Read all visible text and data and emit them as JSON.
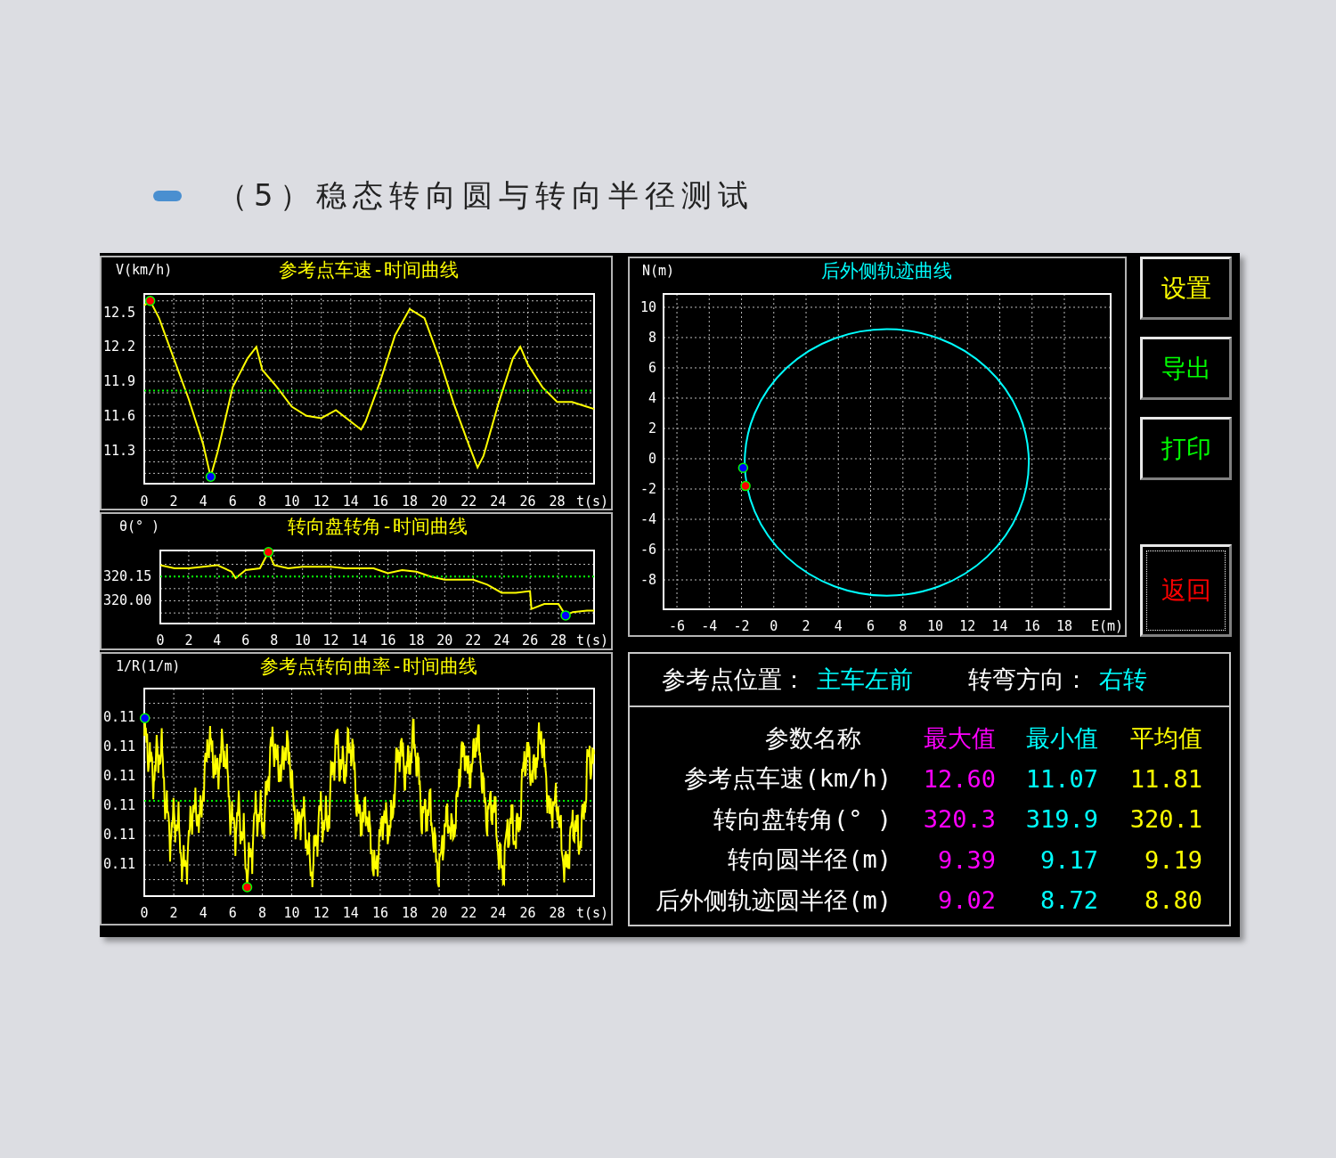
{
  "page_title": "（5）稳态转向圆与转向半径测试",
  "speed_chart": {
    "chart_data": {
      "type": "line",
      "title": "参考点车速-时间曲线",
      "xlabel": "t(s)",
      "ylabel": "V(km/h)",
      "x": [
        0,
        0.4,
        1,
        2,
        3,
        4,
        4.5,
        5,
        6,
        7,
        7.6,
        8,
        9,
        10,
        11,
        12,
        13,
        14,
        14.7,
        15,
        16,
        17,
        18,
        19,
        20,
        21,
        22,
        22.6,
        23,
        24,
        25,
        25.5,
        26,
        27,
        28,
        29,
        30,
        30.5
      ],
      "series": [
        {
          "color": "#ffff00",
          "values": [
            12.56,
            12.6,
            12.45,
            12.1,
            11.75,
            11.35,
            11.07,
            11.3,
            11.85,
            12.1,
            12.2,
            12.0,
            11.85,
            11.68,
            11.6,
            11.58,
            11.65,
            11.55,
            11.48,
            11.55,
            11.9,
            12.3,
            12.53,
            12.45,
            12.1,
            11.7,
            11.35,
            11.15,
            11.25,
            11.7,
            12.1,
            12.2,
            12.05,
            11.85,
            11.72,
            11.72,
            11.68,
            11.66
          ]
        },
        {
          "color": "#00ff00",
          "line_style": "dotted",
          "values": [
            11.82,
            11.82,
            11.82,
            11.82,
            11.82,
            11.82,
            11.82,
            11.82,
            11.82,
            11.82,
            11.82,
            11.82,
            11.82,
            11.82,
            11.82,
            11.82,
            11.82,
            11.82,
            11.82,
            11.82,
            11.82,
            11.82,
            11.82,
            11.82,
            11.82,
            11.82,
            11.82,
            11.82,
            11.82,
            11.82,
            11.82,
            11.82,
            11.82,
            11.82,
            11.82,
            11.82,
            11.82,
            11.82
          ]
        }
      ],
      "xlim": [
        0,
        30.5
      ],
      "ylim": [
        11.01,
        12.66
      ],
      "xticks": [
        0,
        2,
        4,
        6,
        8,
        10,
        12,
        14,
        16,
        18,
        20,
        22,
        24,
        26,
        28
      ],
      "yticks": [
        12.5,
        12.2,
        11.9,
        11.6,
        11.3
      ],
      "grid": true
    }
  },
  "steering_chart": {
    "chart_data": {
      "type": "line",
      "title": "转向盘转角-时间曲线",
      "xlabel": "t(s)",
      "ylabel": "θ(° )",
      "x": [
        0,
        1,
        2,
        3,
        4,
        5,
        5.3,
        6,
        7,
        7.6,
        8,
        9,
        10,
        11,
        12,
        13,
        14,
        15,
        16,
        17,
        18,
        19,
        20,
        21,
        22,
        23,
        24,
        25,
        26,
        26.1,
        27,
        28,
        28.5,
        29,
        30,
        30.5
      ],
      "series": [
        {
          "color": "#ffff00",
          "values": [
            320.22,
            320.2,
            320.2,
            320.21,
            320.22,
            320.18,
            320.14,
            320.19,
            320.2,
            320.3,
            320.22,
            320.2,
            320.21,
            320.21,
            320.21,
            320.2,
            320.2,
            320.2,
            320.17,
            320.19,
            320.18,
            320.15,
            320.13,
            320.13,
            320.13,
            320.1,
            320.05,
            320.05,
            320.06,
            319.95,
            319.98,
            319.98,
            319.91,
            319.93,
            319.94,
            319.94
          ]
        },
        {
          "color": "#00ff00",
          "line_style": "dotted",
          "values": [
            320.15,
            320.15,
            320.15,
            320.15,
            320.15,
            320.15,
            320.15,
            320.15,
            320.15,
            320.15,
            320.15,
            320.15,
            320.15,
            320.15,
            320.15,
            320.15,
            320.15,
            320.15,
            320.15,
            320.15,
            320.15,
            320.15,
            320.15,
            320.15,
            320.15,
            320.15,
            320.15,
            320.15,
            320.15,
            320.15,
            320.15,
            320.15,
            320.15,
            320.15,
            320.15,
            320.15
          ]
        }
      ],
      "xlim": [
        0,
        30.5
      ],
      "ylim": [
        319.86,
        320.31
      ],
      "xticks": [
        0,
        2,
        4,
        6,
        8,
        10,
        12,
        14,
        16,
        18,
        20,
        22,
        24,
        26,
        28
      ],
      "yticks": [
        {
          "value": 320.15,
          "label": "320.15"
        },
        {
          "value": 320.0,
          "label": "320.00"
        }
      ],
      "grid": true
    }
  },
  "curvature_chart": {
    "title": "参考点转向曲率-时间曲线",
    "ylabel": "1/R(1/m)",
    "xlabel": "t(s)",
    "y_labels": [
      "0.11",
      "0.11",
      "0.11",
      "0.11",
      "0.11",
      "0.11"
    ],
    "x_labels": [
      "0",
      "2",
      "4",
      "6",
      "8",
      "10",
      "12",
      "14",
      "16",
      "18",
      "20",
      "22",
      "24",
      "26",
      "28"
    ]
  },
  "trajectory_chart": {
    "title": "后外侧轨迹曲线",
    "ylabel": "N(m)",
    "xlabel": "E(m)",
    "y_labels": [
      "10",
      "8",
      "6",
      "4",
      "2",
      "0",
      "-2",
      "-4",
      "-6",
      "-8"
    ],
    "x_labels": [
      "-6",
      "-4",
      "-2",
      "0",
      "2",
      "4",
      "6",
      "8",
      "10",
      "12",
      "14",
      "16",
      "18"
    ]
  },
  "buttons": [
    {
      "label": "设置",
      "color": "#ffff00",
      "focused": false
    },
    {
      "label": "导出",
      "color": "#00ff00",
      "focused": false
    },
    {
      "label": "打印",
      "color": "#00ff00",
      "focused": false
    },
    {
      "label": "返回",
      "color": "#ff0000",
      "focused": true
    }
  ],
  "info": {
    "reference_label": "参考点位置：",
    "reference_value": "主车左前",
    "direction_label": "转弯方向：",
    "direction_value": "右转"
  },
  "table": {
    "columns": [
      {
        "label": "参数名称",
        "color": "#ffffff"
      },
      {
        "label": "最大值",
        "color": "#ff00ff"
      },
      {
        "label": "最小值",
        "color": "#00ffff"
      },
      {
        "label": "平均值",
        "color": "#ffff00"
      }
    ],
    "rows": [
      {
        "name": "参考点车速(km/h)",
        "values": [
          "12.60",
          "11.07",
          "11.81"
        ]
      },
      {
        "name": "转向盘转角(° )",
        "values": [
          "320.3",
          "319.9",
          "320.1"
        ]
      },
      {
        "name": "转向圆半径(m)",
        "values": [
          "9.39",
          "9.17",
          "9.19"
        ]
      },
      {
        "name": "后外侧轨迹圆半径(m)",
        "values": [
          "9.02",
          "8.72",
          "8.80"
        ]
      }
    ]
  }
}
